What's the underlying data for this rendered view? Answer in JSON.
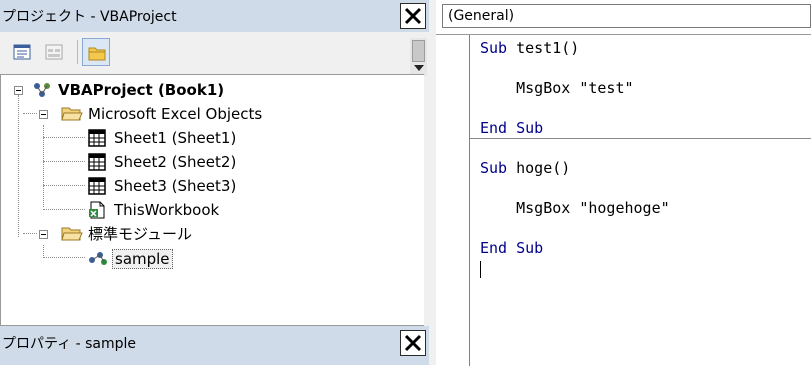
{
  "project_panel": {
    "title": "プロジェクト - VBAProject",
    "toolbar": [
      {
        "name": "view-code",
        "icon": "view-code-icon"
      },
      {
        "name": "view-object",
        "icon": "view-object-icon"
      },
      {
        "name": "toggle-folders",
        "icon": "folder-icon",
        "pressed": true
      }
    ],
    "tree": {
      "root": "VBAProject (Book1)",
      "folder_excel": "Microsoft Excel Objects",
      "sheet1": "Sheet1 (Sheet1)",
      "sheet2": "Sheet2 (Sheet2)",
      "sheet3": "Sheet3 (Sheet3)",
      "thisworkbook": "ThisWorkbook",
      "folder_modules": "標準モジュール",
      "module_sample": "sample"
    }
  },
  "properties_panel": {
    "title": "プロパティ - sample"
  },
  "code_window": {
    "object_combo": "(General)",
    "lines": {
      "l1_kw": "Sub",
      "l1_rest": " test1()",
      "l2_kw": "",
      "l2_rest": "    MsgBox \"test\"",
      "l3_kw": "End Sub",
      "l3_rest": "",
      "l4_kw": "Sub",
      "l4_rest": " hoge()",
      "l5_kw": "",
      "l5_rest": "    MsgBox \"hogehoge\"",
      "l6_kw": "End Sub",
      "l6_rest": ""
    }
  },
  "colors": {
    "titlebar": "#cfdbe9",
    "keyword": "#00008b",
    "panel_bg": "#f0f0f0"
  }
}
